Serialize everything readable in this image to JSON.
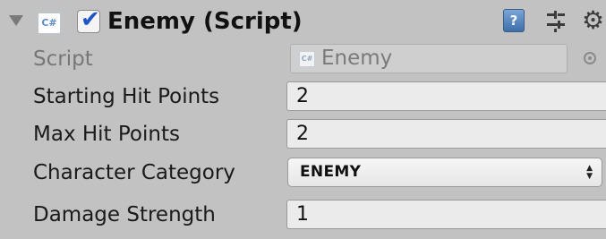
{
  "component": {
    "title": "Enemy (Script)",
    "icon_text": "C#",
    "enabled": true
  },
  "fields": {
    "script": {
      "label": "Script",
      "value": "Enemy",
      "icon_text": "C#"
    },
    "starting_hit_points": {
      "label": "Starting Hit Points",
      "value": "2"
    },
    "max_hit_points": {
      "label": "Max Hit Points",
      "value": "2"
    },
    "character_category": {
      "label": "Character Category",
      "value": "ENEMY"
    },
    "damage_strength": {
      "label": "Damage Strength",
      "value": "1"
    }
  },
  "icons": {
    "foldout": "triangle-down-icon",
    "help": "help-book-icon",
    "presets": "sliders-icon",
    "settings": "gear-icon",
    "object_picker": "target-circle-icon"
  },
  "colors": {
    "panel_bg": "#c2c2c2",
    "field_bg": "#ebebeb",
    "checkbox_tick": "#1d55c7"
  }
}
